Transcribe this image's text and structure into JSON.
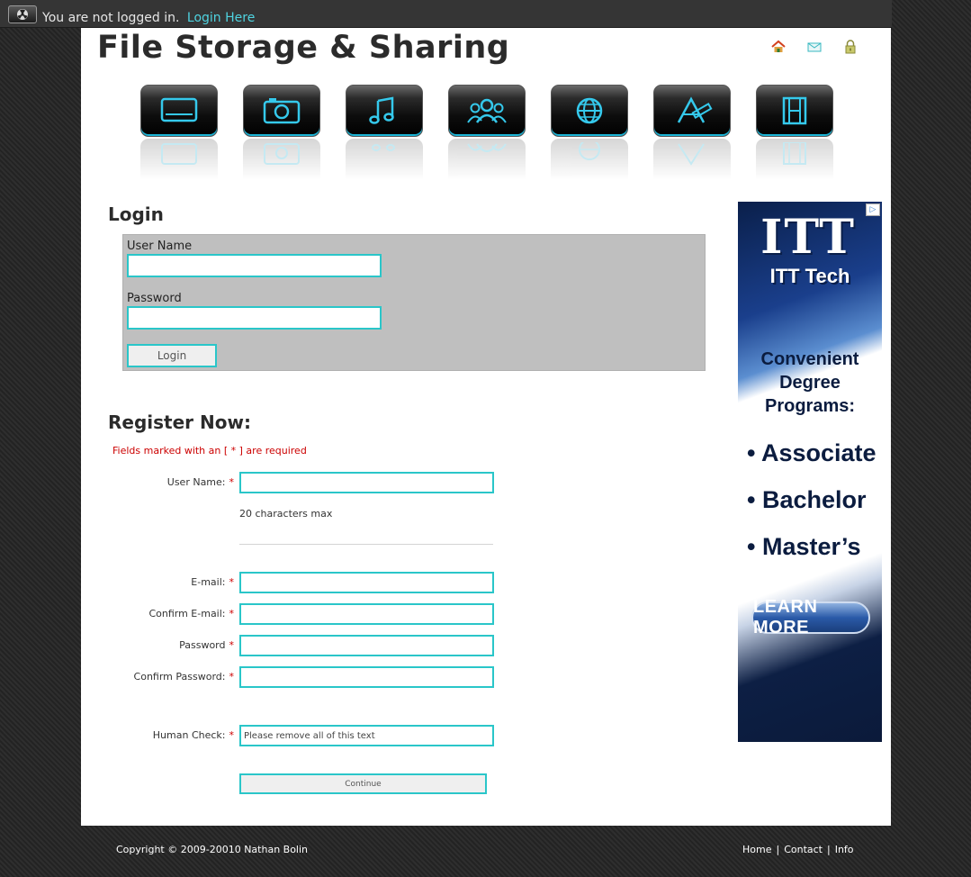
{
  "topbar": {
    "message": "You are not logged in.",
    "login_link": "Login Here"
  },
  "header": {
    "title": "File Storage & Sharing",
    "icons": [
      "home-icon",
      "mail-icon",
      "lock-icon"
    ]
  },
  "nav": {
    "items": [
      {
        "icon": "desktop-icon"
      },
      {
        "icon": "camera-icon"
      },
      {
        "icon": "music-icon"
      },
      {
        "icon": "users-icon"
      },
      {
        "icon": "globe-icon"
      },
      {
        "icon": "apps-icon"
      },
      {
        "icon": "film-icon"
      }
    ]
  },
  "login": {
    "heading": "Login",
    "username_label": "User Name",
    "password_label": "Password",
    "button": "Login"
  },
  "register": {
    "heading": "Register Now:",
    "required_note": "Fields marked with an [ * ] are required",
    "required_mark": "*",
    "username_label": "User Name:",
    "username_hint": "20 characters max",
    "email_label": "E-mail:",
    "confirm_email_label": "Confirm E-mail:",
    "password_label": "Password",
    "confirm_password_label": "Confirm Password:",
    "human_check_label": "Human Check:",
    "human_check_value": "Please remove all of this text",
    "continue_button": "Continue"
  },
  "ad": {
    "logo": "ITT",
    "brand": "ITT Tech",
    "pitch_line1": "Convenient",
    "pitch_line2": "Degree",
    "pitch_line3": "Programs:",
    "degree1": "Associate",
    "degree2": "Bachelor",
    "degree3": "Master’s",
    "bullet": "•",
    "cta": "LEARN MORE",
    "adchoices": "▷"
  },
  "footer": {
    "copyright": "Copyright © 2009-20010 Nathan Bolin",
    "links": [
      "Home",
      "Contact",
      "Info"
    ],
    "separator": "|"
  },
  "colors": {
    "accent_cyan": "#2ac6c9",
    "link_cyan": "#4fd3e0",
    "required_red": "#cc0000",
    "login_box_gray": "#bfbfbf"
  }
}
